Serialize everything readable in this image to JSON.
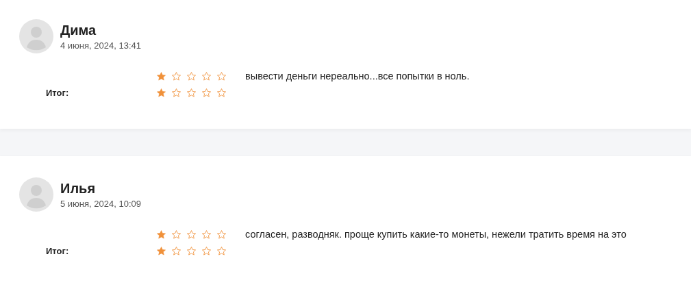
{
  "reviews": [
    {
      "name": "Дима",
      "date": "4 июня, 2024, 13:41",
      "ratings": [
        {
          "stars": 1,
          "comment": "вывести деньги нереально...все попытки в ноль."
        },
        {
          "label": "Итог:",
          "stars": 1
        }
      ]
    },
    {
      "name": "Илья",
      "date": "5 июня, 2024, 10:09",
      "ratings": [
        {
          "stars": 1,
          "comment": "согласен, разводняк. проще купить какие-то монеты, нежели тратить время на это"
        },
        {
          "label": "Итог:",
          "stars": 1
        }
      ]
    }
  ]
}
